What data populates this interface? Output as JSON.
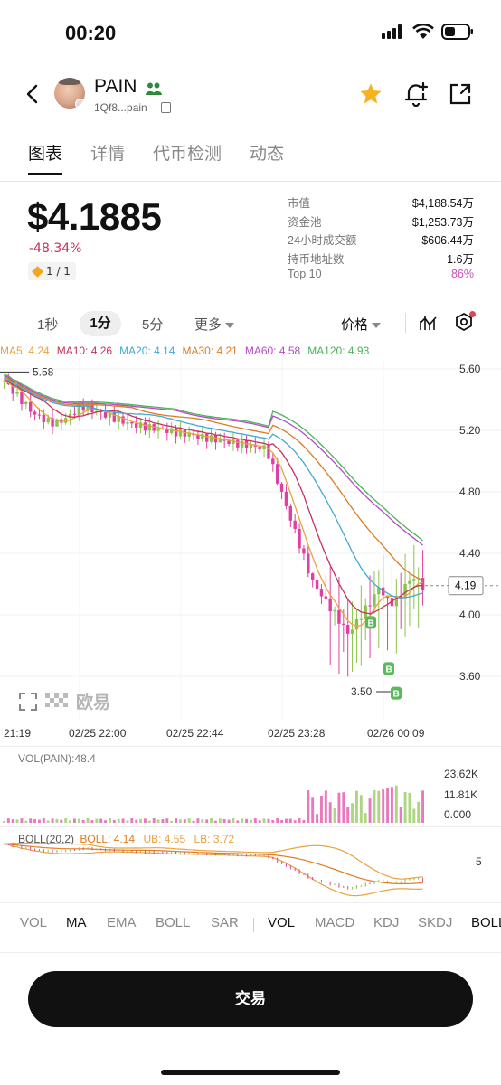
{
  "status_bar": {
    "time": "00:20"
  },
  "header": {
    "coin_name": "PAIN",
    "address": "1Qf8...pain",
    "icons": [
      "back-icon",
      "people-icon",
      "copy-icon",
      "star-icon",
      "bell-plus-icon",
      "share-icon"
    ],
    "star_color": "#F5B323"
  },
  "tabs": [
    "图表",
    "详情",
    "代币检测",
    "动态"
  ],
  "summary": {
    "price": "$4.1885",
    "change": "-48.34%",
    "rank": "1 / 1",
    "stats": [
      {
        "label": "市值",
        "value": "$4,188.54万"
      },
      {
        "label": "资金池",
        "value": "$1,253.73万"
      },
      {
        "label": "24小时成交额",
        "value": "$606.44万"
      },
      {
        "label": "持币地址数",
        "value": "1.6万"
      },
      {
        "label": "Top 10",
        "value": "86%"
      }
    ]
  },
  "timeframes": {
    "items": [
      "1秒",
      "1分",
      "5分",
      "更多"
    ],
    "active": "1分",
    "price_label": "价格"
  },
  "ma": [
    {
      "label": "MA5: 4.24",
      "color": "#E8A33C"
    },
    {
      "label": "MA10: 4.26",
      "color": "#C8315A"
    },
    {
      "label": "MA20: 4.14",
      "color": "#3FA9D6"
    },
    {
      "label": "MA30: 4.21",
      "color": "#E07B1F"
    },
    {
      "label": "MA60: 4.58",
      "color": "#B44BC7"
    },
    {
      "label": "MA120: 4.93",
      "color": "#4DB45A"
    }
  ],
  "chart": {
    "y_ticks": [
      "5.60",
      "5.20",
      "4.80",
      "4.40",
      "4.00",
      "3.60"
    ],
    "high_label": "5.58",
    "low_label": "3.50",
    "current_label": "4.19",
    "buy_marker": "B",
    "time_ticks": [
      "21:19",
      "02/25 22:00",
      "02/25 22:44",
      "02/25 23:28",
      "02/26 00:09"
    ],
    "watermark": "欧易"
  },
  "volume": {
    "label": "VOL(PAIN):48.4",
    "ticks": [
      "23.62K",
      "11.81K",
      "0.000"
    ]
  },
  "boll": {
    "label": "BOLL(20,2)",
    "boll": "BOLL: 4.14",
    "ub": "UB: 4.55",
    "lb": "LB: 3.72",
    "tick": "5"
  },
  "indicators": {
    "main": [
      "VOL",
      "MA",
      "EMA",
      "BOLL",
      "SAR"
    ],
    "sub": [
      "VOL",
      "MACD",
      "KDJ",
      "SKDJ",
      "BOLL"
    ]
  },
  "trade_button": "交易"
}
